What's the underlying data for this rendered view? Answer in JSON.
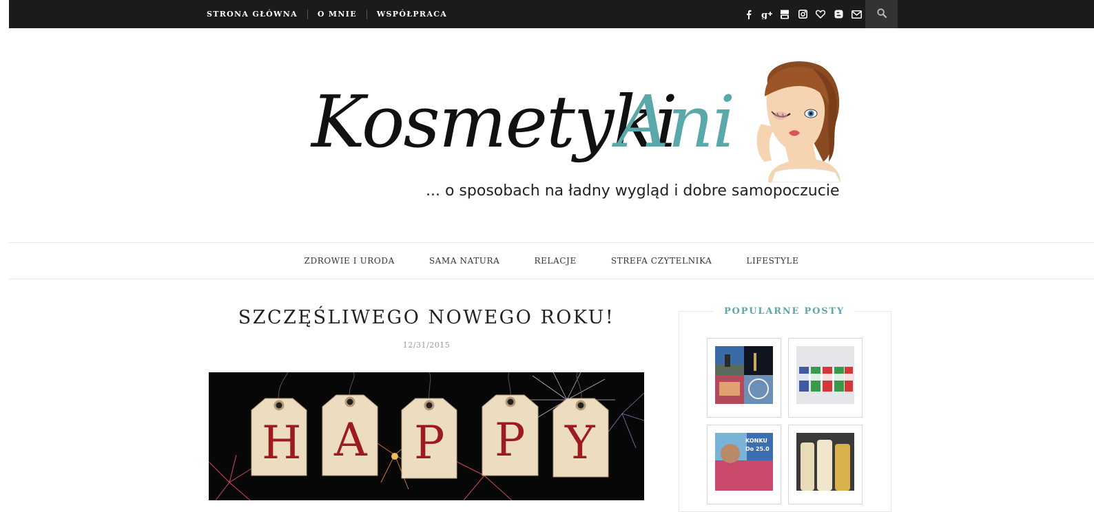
{
  "topbar": {
    "nav": [
      "STRONA GŁÓWNA",
      "O MNIE",
      "WSPÓŁPRACA"
    ],
    "social_icons": [
      "facebook-icon",
      "google-plus-icon",
      "youtube-icon",
      "instagram-icon",
      "bloglovin-heart-icon",
      "blogger-icon",
      "email-icon"
    ],
    "search_icon": "search-icon"
  },
  "header": {
    "logo_part1": "Kosmetyki",
    "logo_part2": "Ani",
    "tagline": "... o sposobach na ładny wygląd i dobre samopoczucie"
  },
  "category_nav": [
    "ZDROWIE I URODA",
    "SAMA NATURA",
    "RELACJE",
    "STREFA CZYTELNIKA",
    "LIFESTYLE"
  ],
  "post": {
    "title": "SZCZĘŚLIWEGO NOWEGO ROKU!",
    "date": "12/31/2015",
    "image_letters": [
      "H",
      "A",
      "P",
      "P",
      "Y"
    ]
  },
  "sidebar": {
    "widget_title": "POPULARNE POSTY",
    "thumb_text": "KONKU\nDo 25.0"
  },
  "colors": {
    "accent": "#5ba8ab",
    "topbar": "#1b1b1b",
    "search_bg": "#333333",
    "tag_letter": "#9b1b1f"
  }
}
